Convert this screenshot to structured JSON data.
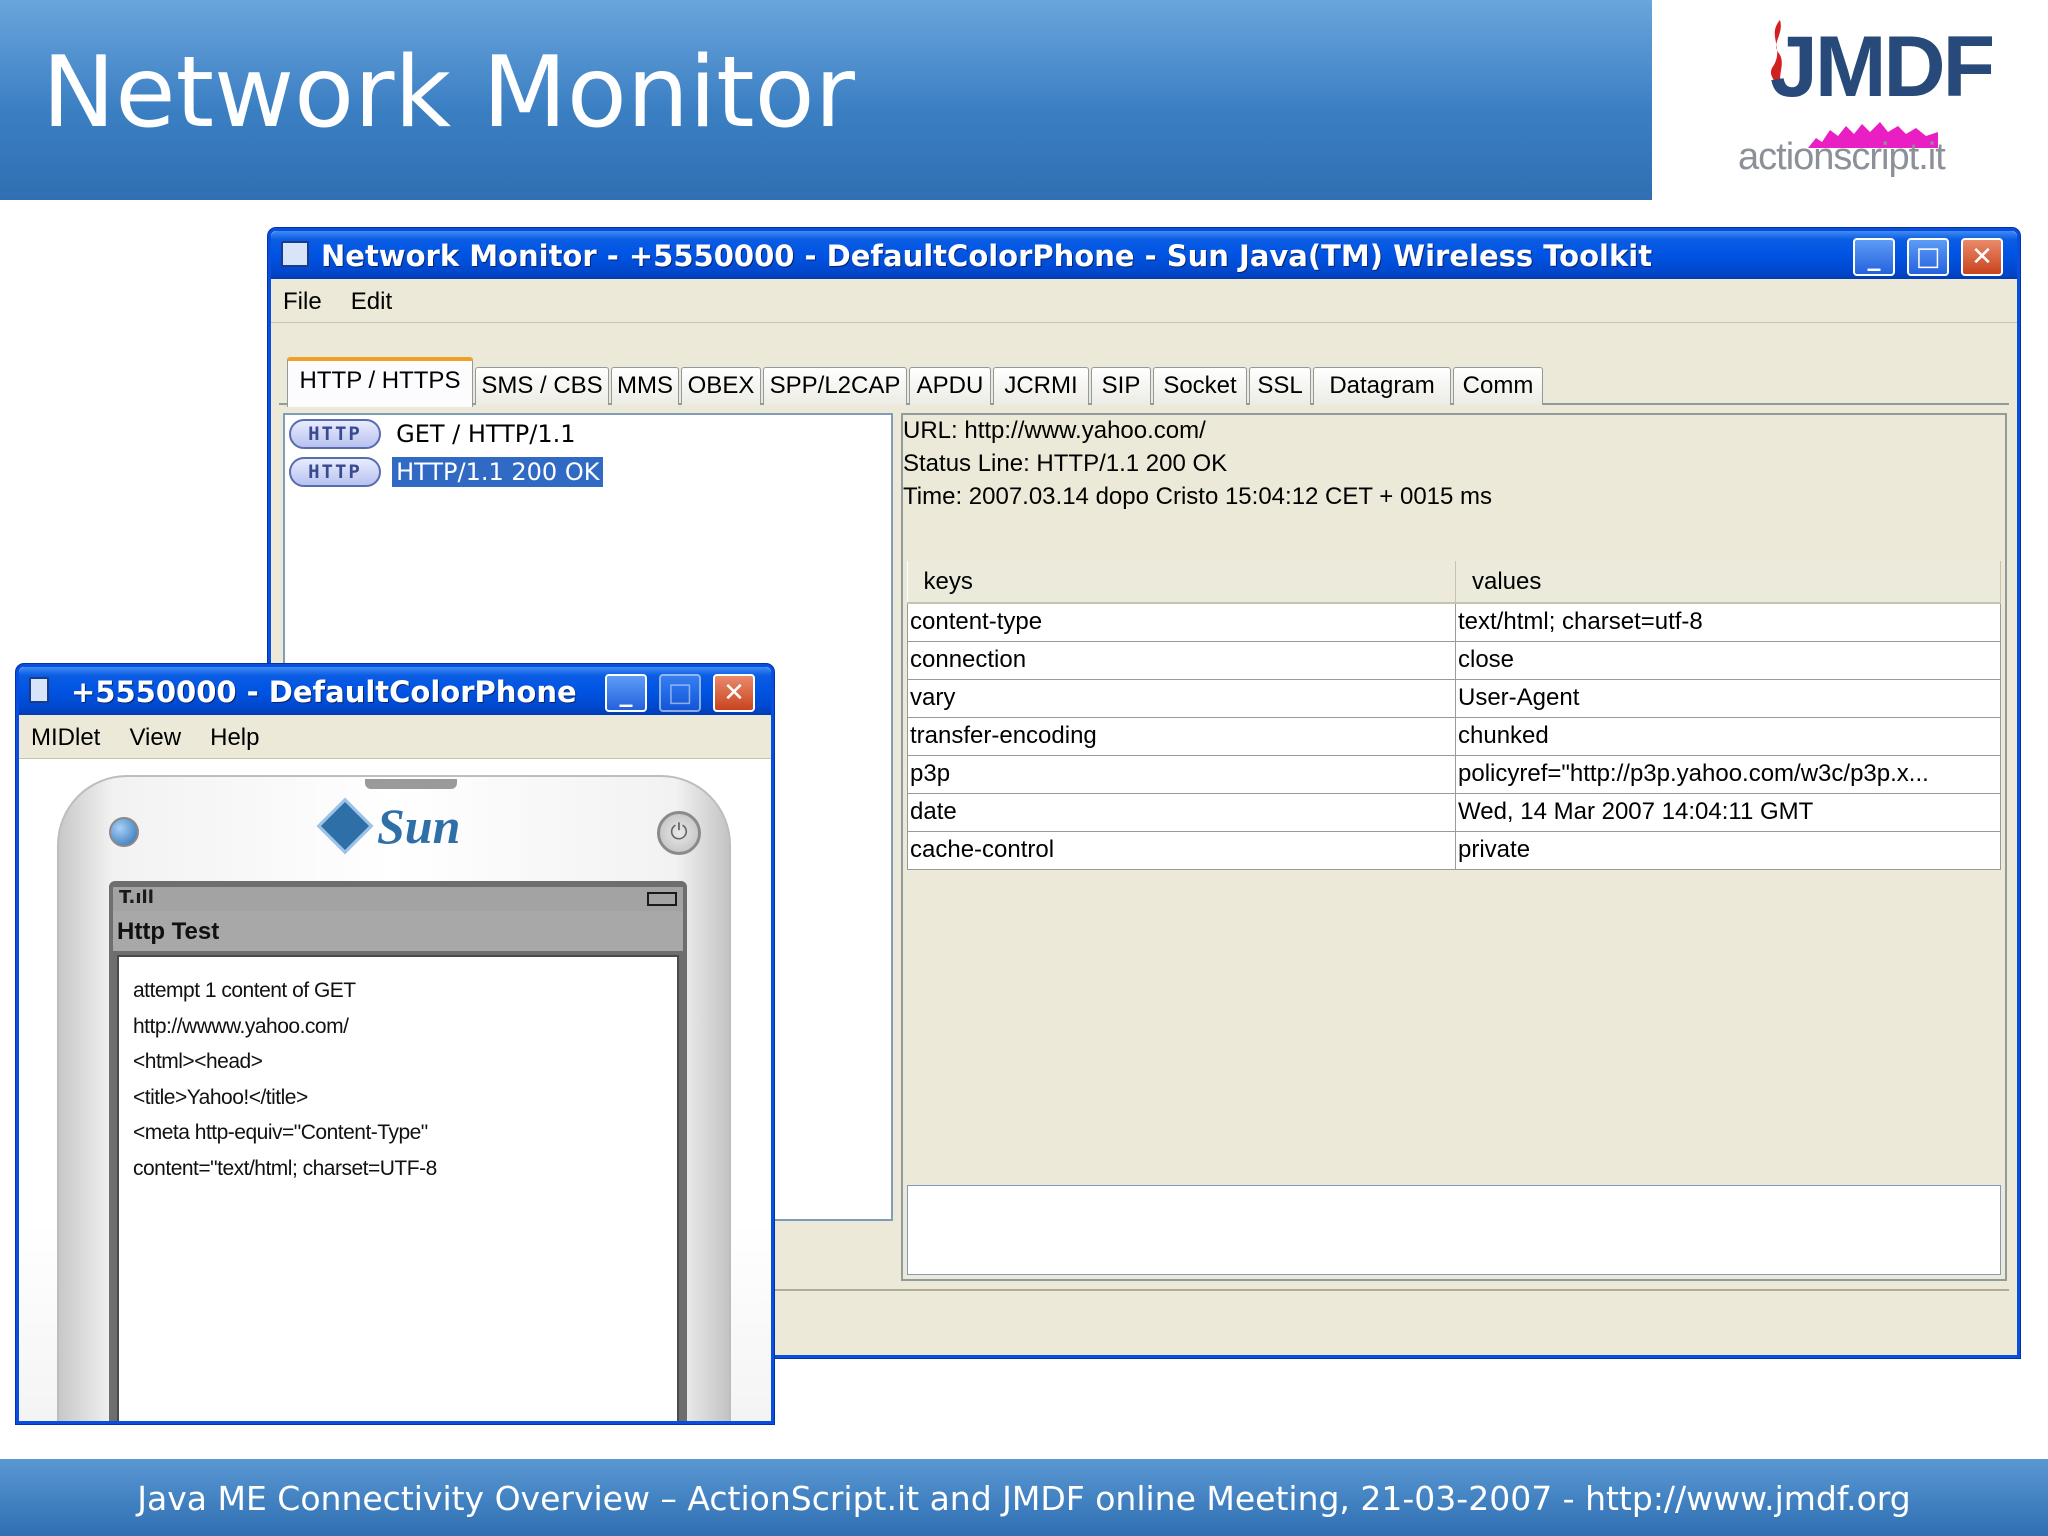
{
  "slide": {
    "title": "Network Monitor",
    "footer": "Java ME Connectivity Overview – ActionScript.it and JMDF online Meeting, 21-03-2007 - http://www.jmdf.org"
  },
  "logo": {
    "top": "JMDF",
    "bottom": "actionscript.it"
  },
  "network_monitor": {
    "window_title": "Network Monitor - +5550000 - DefaultColorPhone - Sun Java(TM) Wireless Toolkit",
    "menu": [
      "File",
      "Edit"
    ],
    "tabs": [
      "HTTP / HTTPS",
      "SMS / CBS",
      "MMS",
      "OBEX",
      "SPP/L2CAP",
      "APDU",
      "JCRMI",
      "SIP",
      "Socket",
      "SSL",
      "Datagram",
      "Comm"
    ],
    "active_tab": "HTTP / HTTPS",
    "requests": [
      {
        "badge": "HTTP",
        "text": "GET / HTTP/1.1",
        "selected": false
      },
      {
        "badge": "HTTP",
        "text": "HTTP/1.1 200 OK",
        "selected": true
      }
    ],
    "details": {
      "url": "URL: http://www.yahoo.com/",
      "status_line": "Status Line: HTTP/1.1 200 OK",
      "time": "Time: 2007.03.14 dopo Cristo  15:04:12 CET + 0015 ms"
    },
    "headers_table": {
      "columns": [
        "keys",
        "values"
      ],
      "rows": [
        [
          "content-type",
          "text/html; charset=utf-8"
        ],
        [
          "connection",
          "close"
        ],
        [
          "vary",
          "User-Agent"
        ],
        [
          "transfer-encoding",
          "chunked"
        ],
        [
          "p3p",
          "policyref=\"http://p3p.yahoo.com/w3c/p3p.x..."
        ],
        [
          "date",
          "Wed, 14 Mar 2007 14:04:11 GMT"
        ],
        [
          "cache-control",
          "private"
        ]
      ]
    }
  },
  "phone": {
    "window_title": "+5550000 - DefaultColorPhone",
    "menu": [
      "MIDlet",
      "View",
      "Help"
    ],
    "brand": "Sun",
    "screen_title": "Http Test",
    "signal_text": "T.ıll",
    "content_lines": [
      "attempt 1 content of GET",
      "http://wwww.yahoo.com/",
      "<html><head>",
      "<title>Yahoo!</title>",
      "<meta http-equiv=\"Content-Type\"",
      "content=\"text/html; charset=UTF-8"
    ]
  },
  "colors": {
    "header_blue": "#3b7fc3",
    "xp_title_blue": "#0054e3",
    "selection_blue": "#316ac5",
    "tab_accent": "#f0a026"
  }
}
